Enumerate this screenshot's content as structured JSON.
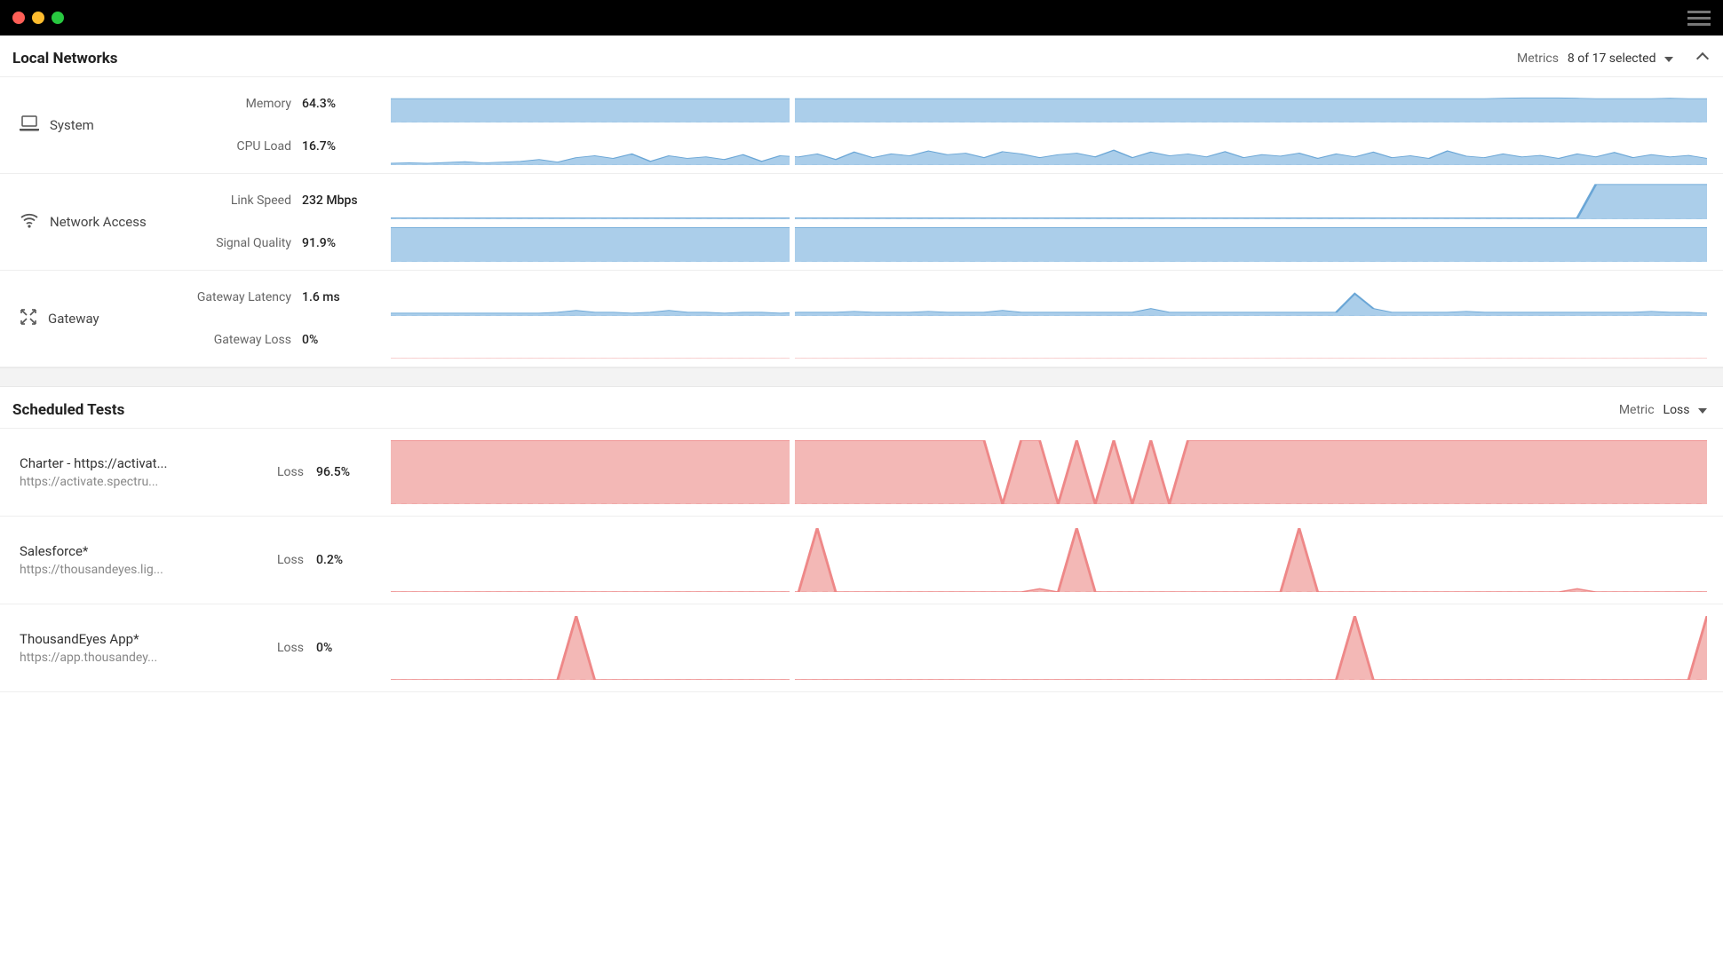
{
  "titlebar": {
    "hamburger": "menu"
  },
  "local_networks": {
    "title": "Local Networks",
    "metrics_label": "Metrics",
    "metrics_value": "8 of 17 selected",
    "categories": [
      {
        "icon": "laptop",
        "name": "System",
        "metrics": [
          {
            "name": "Memory",
            "value": "64.3%"
          },
          {
            "name": "CPU Load",
            "value": "16.7%"
          }
        ]
      },
      {
        "icon": "wifi",
        "name": "Network Access",
        "metrics": [
          {
            "name": "Link Speed",
            "value": "232 Mbps"
          },
          {
            "name": "Signal Quality",
            "value": "91.9%"
          }
        ]
      },
      {
        "icon": "gateway",
        "name": "Gateway",
        "metrics": [
          {
            "name": "Gateway Latency",
            "value": "1.6 ms"
          },
          {
            "name": "Gateway Loss",
            "value": "0%"
          }
        ]
      }
    ]
  },
  "scheduled_tests": {
    "title": "Scheduled Tests",
    "metric_label": "Metric",
    "metric_value": "Loss",
    "tests": [
      {
        "name": "Charter - https://activat...",
        "url": "https://activate.spectru...",
        "metric": "Loss",
        "value": "96.5%"
      },
      {
        "name": "Salesforce*",
        "url": "https://thousandeyes.lig...",
        "metric": "Loss",
        "value": "0.2%"
      },
      {
        "name": "ThousandEyes App*",
        "url": "https://app.thousandey...",
        "metric": "Loss",
        "value": "0%"
      }
    ]
  },
  "chart_data": [
    {
      "type": "area",
      "title": "Memory",
      "ylim": [
        0,
        100
      ],
      "baseline_pct": 64,
      "values": [
        64,
        64,
        64,
        64,
        64,
        64,
        64,
        64,
        64,
        64,
        64,
        64,
        64,
        64,
        64,
        64,
        64,
        64,
        64,
        64,
        64,
        64,
        64,
        64,
        64,
        64,
        64,
        64,
        64,
        64,
        64,
        64,
        64,
        64,
        64,
        64,
        64,
        64,
        64,
        64,
        64,
        64,
        64,
        64,
        64,
        64,
        64,
        64,
        64,
        64,
        64,
        64,
        64,
        64,
        64,
        64,
        64,
        64,
        64,
        64,
        65,
        66,
        66,
        66,
        65,
        64,
        64,
        64,
        64,
        65,
        64,
        64
      ],
      "color": "#a2c9e8"
    },
    {
      "type": "area",
      "title": "CPU Load",
      "ylim": [
        0,
        100
      ],
      "values": [
        5,
        6,
        5,
        7,
        9,
        6,
        8,
        10,
        15,
        8,
        20,
        25,
        18,
        30,
        10,
        25,
        18,
        22,
        15,
        28,
        10,
        25,
        22,
        30,
        15,
        35,
        20,
        30,
        25,
        38,
        28,
        32,
        20,
        36,
        30,
        20,
        28,
        32,
        22,
        40,
        20,
        35,
        25,
        30,
        22,
        36,
        20,
        28,
        24,
        32,
        18,
        30,
        22,
        35,
        20,
        25,
        18,
        38,
        24,
        20,
        30,
        22,
        26,
        18,
        30,
        22,
        34,
        20,
        28,
        22,
        26,
        18
      ],
      "color": "#a2c9e8"
    },
    {
      "type": "area",
      "title": "Link Speed",
      "ylim": [
        0,
        300
      ],
      "values": [
        10,
        10,
        10,
        10,
        10,
        10,
        10,
        10,
        10,
        10,
        10,
        10,
        10,
        10,
        10,
        10,
        10,
        10,
        10,
        10,
        10,
        10,
        10,
        10,
        10,
        10,
        10,
        10,
        10,
        10,
        10,
        10,
        10,
        10,
        10,
        10,
        10,
        10,
        10,
        10,
        10,
        10,
        10,
        10,
        10,
        10,
        10,
        10,
        10,
        10,
        10,
        10,
        10,
        10,
        10,
        10,
        10,
        10,
        10,
        10,
        10,
        10,
        10,
        10,
        10,
        280,
        280,
        280,
        280,
        280,
        280,
        280
      ],
      "color": "#a2c9e8"
    },
    {
      "type": "area",
      "title": "Signal Quality",
      "ylim": [
        0,
        100
      ],
      "values": [
        92,
        92,
        92,
        92,
        92,
        92,
        92,
        92,
        92,
        92,
        92,
        92,
        92,
        92,
        92,
        92,
        92,
        92,
        92,
        92,
        92,
        92,
        92,
        92,
        92,
        92,
        92,
        92,
        92,
        92,
        92,
        92,
        92,
        92,
        92,
        92,
        92,
        92,
        92,
        92,
        92,
        92,
        92,
        92,
        92,
        92,
        92,
        92,
        92,
        92,
        92,
        92,
        92,
        92,
        92,
        92,
        92,
        92,
        92,
        92,
        92,
        92,
        92,
        92,
        92,
        92,
        92,
        92,
        92,
        92,
        92,
        92
      ],
      "color": "#a2c9e8"
    },
    {
      "type": "area",
      "title": "Gateway Latency",
      "ylim": [
        0,
        20
      ],
      "values": [
        1.5,
        1.5,
        1.5,
        1.5,
        1.5,
        1.5,
        1.5,
        1.5,
        1.5,
        2,
        3,
        2,
        2,
        1.5,
        2,
        3,
        2,
        2,
        1.5,
        2,
        2,
        1.5,
        2,
        2,
        2,
        2.5,
        2,
        2,
        2,
        2.5,
        2,
        2,
        2,
        3,
        2,
        2,
        2,
        2,
        2,
        2,
        2,
        4,
        2,
        2,
        2,
        2,
        2,
        2,
        2,
        2,
        2,
        2,
        12,
        4,
        2,
        2,
        2,
        2,
        2.5,
        2,
        2,
        2,
        2,
        2,
        2,
        2,
        2,
        2,
        2.5,
        2,
        2,
        1.5
      ],
      "color": "#a2c9e8"
    },
    {
      "type": "line",
      "title": "Gateway Loss",
      "ylim": [
        0,
        100
      ],
      "values": [
        0,
        0,
        0,
        0,
        0,
        0,
        0,
        0,
        0,
        0,
        0,
        0,
        0,
        0,
        0,
        0,
        0,
        0,
        0,
        0,
        0,
        0,
        0,
        0,
        0,
        0,
        0,
        0,
        0,
        0,
        0,
        0,
        0,
        0,
        0,
        0,
        0,
        0,
        0,
        0,
        0,
        0,
        0,
        0,
        0,
        0,
        0,
        0,
        0,
        0,
        0,
        0,
        0,
        0,
        0,
        0,
        0,
        0,
        0,
        0,
        0,
        0,
        0,
        0,
        0,
        0,
        0,
        0,
        0,
        0,
        0,
        0
      ],
      "color": "#f2b0ae"
    },
    {
      "type": "area",
      "title": "Charter Loss",
      "ylim": [
        0,
        100
      ],
      "values": [
        100,
        100,
        100,
        100,
        100,
        100,
        100,
        100,
        100,
        100,
        100,
        100,
        100,
        100,
        100,
        100,
        100,
        100,
        100,
        100,
        100,
        100,
        100,
        100,
        100,
        100,
        100,
        100,
        100,
        100,
        100,
        100,
        100,
        0,
        100,
        100,
        0,
        100,
        0,
        100,
        0,
        100,
        0,
        100,
        100,
        100,
        100,
        100,
        100,
        100,
        100,
        100,
        100,
        100,
        100,
        100,
        100,
        100,
        100,
        100,
        100,
        100,
        100,
        100,
        100,
        100,
        100,
        100,
        100,
        100,
        100,
        100
      ],
      "color": "#f2b0ae"
    },
    {
      "type": "area",
      "title": "Salesforce Loss",
      "ylim": [
        0,
        100
      ],
      "values": [
        0,
        0,
        0,
        0,
        0,
        0,
        0,
        0,
        0,
        0,
        0,
        0,
        0,
        0,
        0,
        0,
        0,
        0,
        0,
        0,
        0,
        0,
        0,
        100,
        0,
        0,
        0,
        0,
        0,
        0,
        0,
        0,
        0,
        0,
        0,
        5,
        0,
        100,
        0,
        0,
        0,
        0,
        0,
        0,
        0,
        0,
        0,
        0,
        0,
        100,
        0,
        0,
        0,
        0,
        0,
        0,
        0,
        0,
        0,
        0,
        0,
        0,
        0,
        0,
        5,
        0,
        0,
        0,
        0,
        0,
        0,
        0
      ],
      "color": "#f2b0ae"
    },
    {
      "type": "area",
      "title": "ThousandEyes Loss",
      "ylim": [
        0,
        100
      ],
      "values": [
        0,
        0,
        0,
        0,
        0,
        0,
        0,
        0,
        0,
        0,
        100,
        0,
        0,
        0,
        0,
        0,
        0,
        0,
        0,
        0,
        0,
        0,
        0,
        0,
        0,
        0,
        0,
        0,
        0,
        0,
        0,
        0,
        0,
        0,
        0,
        0,
        0,
        0,
        0,
        0,
        0,
        0,
        0,
        0,
        0,
        0,
        0,
        0,
        0,
        0,
        0,
        0,
        100,
        0,
        0,
        0,
        0,
        0,
        0,
        0,
        0,
        0,
        0,
        0,
        0,
        0,
        0,
        0,
        0,
        0,
        0,
        100
      ],
      "color": "#f2b0ae"
    }
  ]
}
